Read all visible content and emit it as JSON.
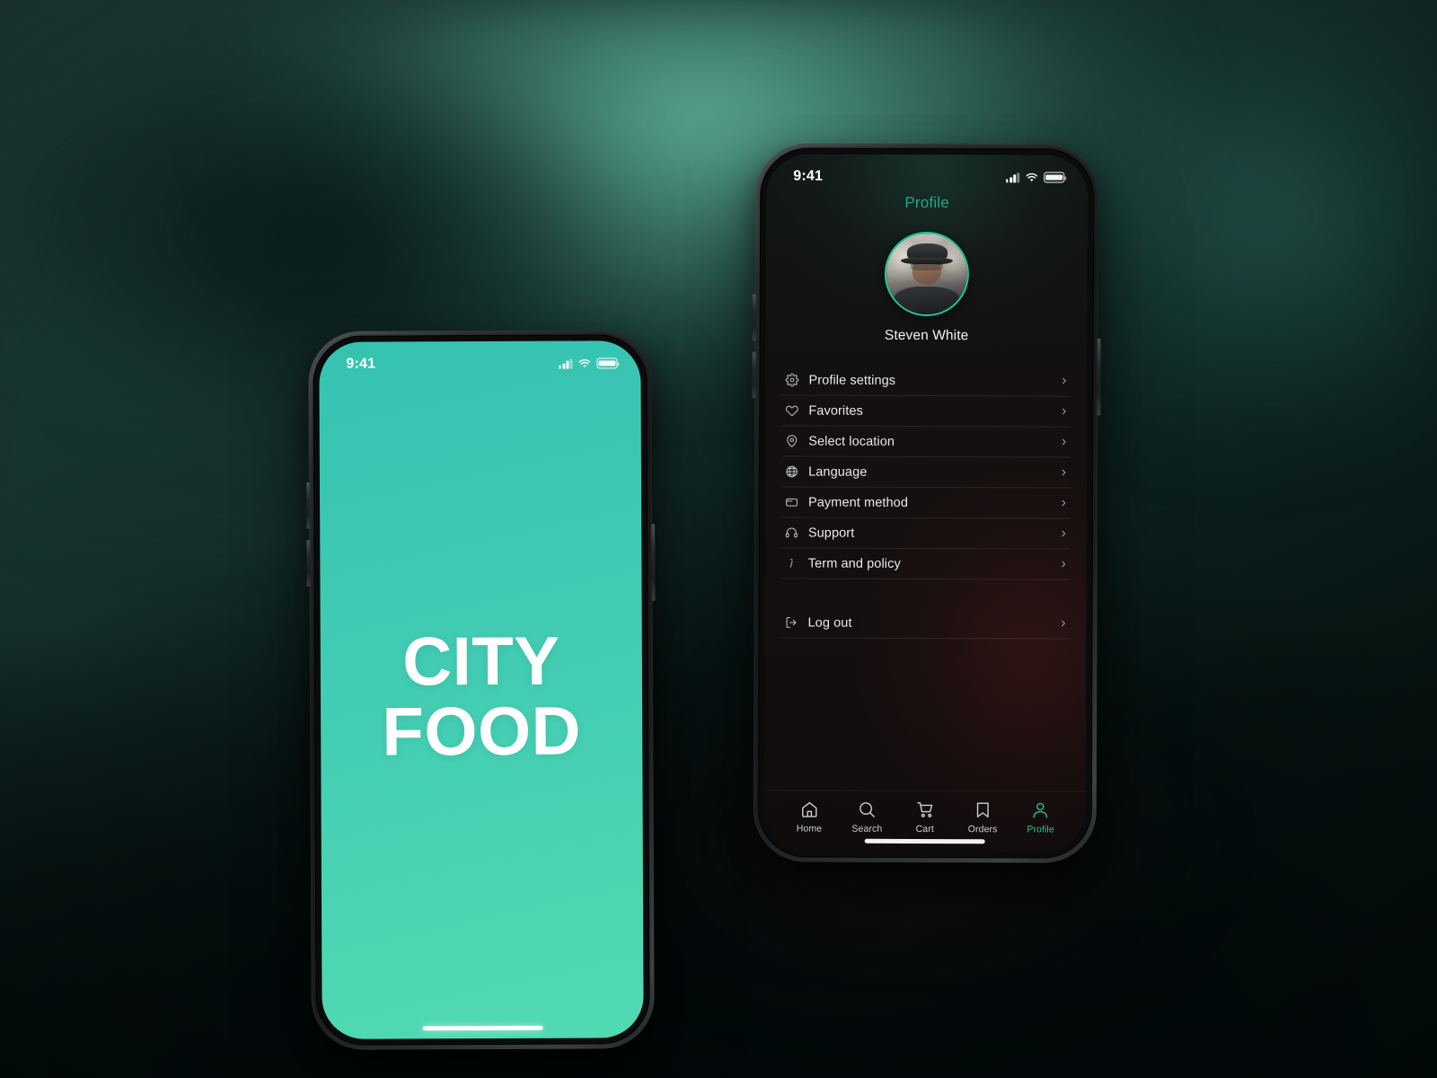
{
  "background": {
    "accent": "#3b8a77",
    "dark": "#061210",
    "mid": "#1c3733"
  },
  "phone_splash": {
    "name": "splash-screen",
    "statusbar": {
      "time": "9:41",
      "signal_icon": "signal-bars-icon",
      "wifi_icon": "wifi-icon",
      "battery_icon": "battery-icon"
    },
    "logo_line1": "CITY",
    "logo_line2": "FOOD",
    "brand_color": "#3dc8b3",
    "home_indicator": "home-indicator"
  },
  "phone_profile": {
    "statusbar": {
      "time": "9:41",
      "signal_icon": "signal-bars-icon",
      "wifi_icon": "wifi-icon",
      "battery_icon": "battery-icon"
    },
    "title": "Profile",
    "title_color": "#1fa98b",
    "avatar": {
      "alt": "Steven White avatar",
      "ring_color": "#1fc79c"
    },
    "user_name": "Steven White",
    "menu": [
      {
        "label": "Profile settings",
        "icon": "gear-icon"
      },
      {
        "label": "Favorites",
        "icon": "heart-icon"
      },
      {
        "label": "Select location",
        "icon": "location-pin-icon"
      },
      {
        "label": "Language",
        "icon": "globe-icon"
      },
      {
        "label": "Payment method",
        "icon": "wallet-icon"
      },
      {
        "label": "Support",
        "icon": "headset-icon"
      },
      {
        "label": "Term and policy",
        "icon": "info-icon"
      }
    ],
    "logout": {
      "label": "Log out",
      "icon": "logout-icon"
    },
    "tabs": [
      {
        "label": "Home",
        "icon": "home-icon",
        "active": false
      },
      {
        "label": "Search",
        "icon": "search-icon",
        "active": false
      },
      {
        "label": "Cart",
        "icon": "cart-icon",
        "active": false
      },
      {
        "label": "Orders",
        "icon": "bookmark-icon",
        "active": false
      },
      {
        "label": "Profile",
        "icon": "person-icon",
        "active": true
      }
    ],
    "active_tab_color": "#1fc79c",
    "home_indicator": "home-indicator"
  }
}
